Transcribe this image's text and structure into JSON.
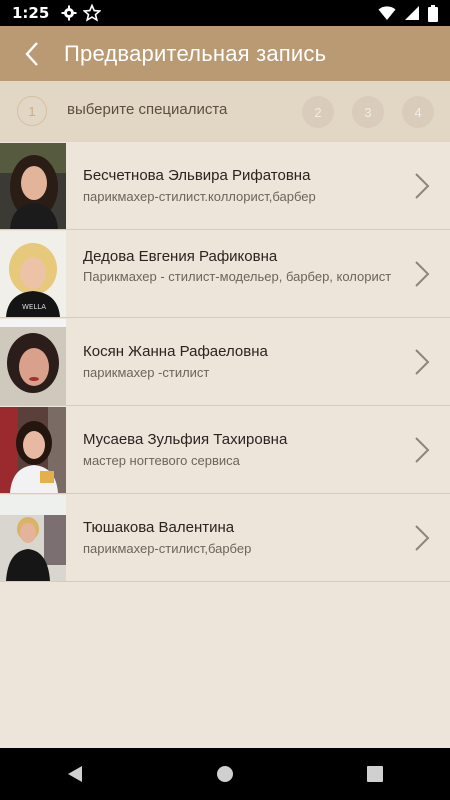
{
  "status": {
    "time": "1:25"
  },
  "app_bar": {
    "title": "Предварительная запись"
  },
  "steps": {
    "active_number": "1",
    "active_label": "выберите специалиста",
    "others": [
      "2",
      "3",
      "4"
    ]
  },
  "specialists": [
    {
      "name": "Бесчетнова Эльвира Рифатовна",
      "role": "парикмахер-стилист.коллорист,барбер"
    },
    {
      "name": "Дедова Евгения Рафиковна",
      "role": "Парикмахер - стилист-модельер, барбер, колорист"
    },
    {
      "name": "Косян Жанна Рафаеловна",
      "role": "парикмахер -стилист"
    },
    {
      "name": "Мусаева Зульфия Тахировна",
      "role": "мастер ногтевого сервиса"
    },
    {
      "name": "Тюшакова Валентина",
      "role": "парикмахер-стилист,барбер"
    }
  ],
  "colors": {
    "app_bar": "#b99a72",
    "steps_bar": "#e2d6c5",
    "background": "#ede4da"
  }
}
